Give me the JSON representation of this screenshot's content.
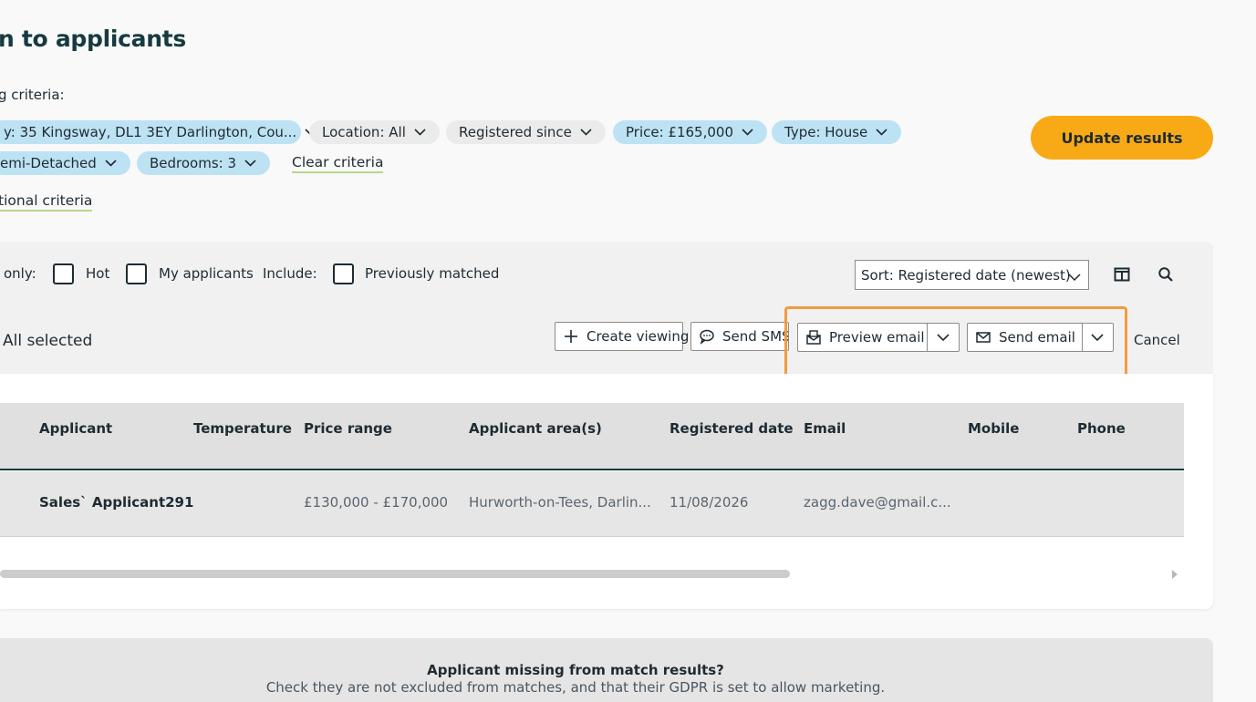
{
  "page": {
    "title": "n to applicants",
    "criteria_label": "g criteria:"
  },
  "criteria": {
    "chips": [
      {
        "label": "y: 35 Kingsway, DL1 3EY Darlington, Cou...",
        "style": "blue"
      },
      {
        "label": "Location: All",
        "style": "grey"
      },
      {
        "label": "Registered since",
        "style": "grey"
      },
      {
        "label": "Price: £165,000",
        "style": "blue"
      },
      {
        "label": "Type: House",
        "style": "blue"
      },
      {
        "label": "emi-Detached",
        "style": "blue"
      },
      {
        "label": "Bedrooms: 3",
        "style": "blue"
      }
    ],
    "clear_label": "Clear criteria",
    "additional_label": "tional criteria",
    "update_label": "Update results"
  },
  "filters": {
    "only_label": "only:",
    "hot_label": "Hot",
    "my_applicants_label": "My applicants",
    "include_label": "Include:",
    "previously_matched_label": "Previously matched",
    "sort_value": "Sort: Registered date (newest)"
  },
  "actions": {
    "selection_label": "All selected",
    "create_viewing_label": "Create viewing",
    "send_sms_label": "Send SMS",
    "preview_email_label": "Preview email",
    "send_email_label": "Send email",
    "cancel_label": "Cancel"
  },
  "table": {
    "columns": [
      "Applicant",
      "Temperature",
      "Price range",
      "Applicant area(s)",
      "Registered date",
      "Email",
      "Mobile",
      "Phone"
    ],
    "rows": [
      {
        "applicant": "Sales` Applicant291",
        "temperature": "",
        "price_range": "£130,000 - £170,000",
        "areas": "Hurworth-on-Tees, Darlin...",
        "registered_date": "11/08/2026",
        "email": "zagg.dave@gmail.c...",
        "mobile": "",
        "phone": ""
      }
    ]
  },
  "notice": {
    "title": "Applicant missing from match results?",
    "body": "Check they are not excluded from matches, and that their GDPR is set to allow marketing."
  },
  "colors": {
    "accent": "#f8aa16",
    "chip_blue": "#bde2f3",
    "highlight": "#f39b3f",
    "link_underline": "#b6d88a"
  }
}
